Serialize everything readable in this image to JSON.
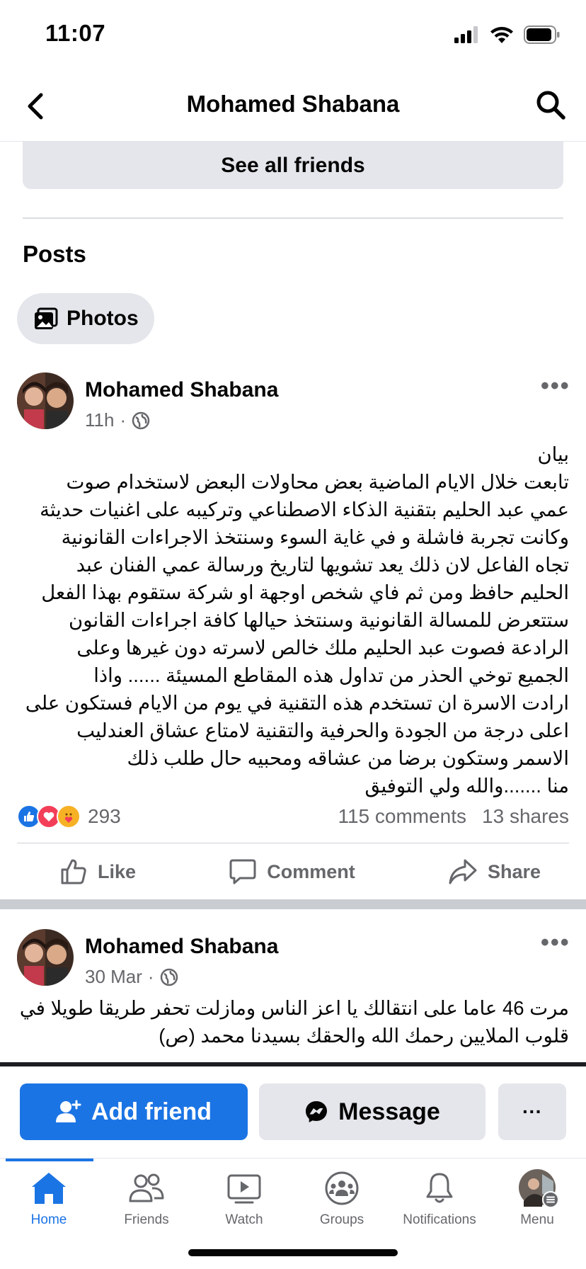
{
  "status_bar": {
    "time": "11:07"
  },
  "header": {
    "title": "Mohamed Shabana"
  },
  "friends": {
    "see_all_label": "See all friends"
  },
  "posts_section": {
    "heading": "Posts",
    "photos_chip": "Photos"
  },
  "post1": {
    "author": "Mohamed Shabana",
    "time": "11h",
    "body_lines": [
      "بيان",
      "تابعت خلال الايام الماضية بعض محاولات البعض لاستخدام صوت",
      "عمي عبد الحليم بتقنية الذكاء الاصطناعي وتركيبه على اغنيات حديثة",
      "وكانت تجربة فاشلة و في غاية السوء وسنتخذ الاجراءات القانونية",
      "تجاه الفاعل لان ذلك يعد تشويها لتاريخ ورسالة عمي الفنان عبد",
      "الحليم حافظ ومن ثم فاي شخص اوجهة او شركة ستقوم بهذا الفعل",
      "ستتعرض للمسالة القانونية وسنتخذ حيالها كافة اجراءات القانون",
      "الرادعة فصوت عبد الحليم ملك خالص لاسرته دون غيرها وعلى",
      "الجميع توخي الحذر من تداول هذه المقاطع المسيئة ...... واذا",
      "ارادت الاسرة ان تستخدم هذه التقنية في يوم من الايام فستكون على",
      "اعلى درجة من الجودة والحرفية والتقنية لامتاع عشاق العندليب",
      "الاسمر وستكون برضا من عشاقه ومحبيه حال طلب ذلك",
      "منا .......والله ولي التوفيق"
    ],
    "reaction_count": "293",
    "comments": "115 comments",
    "shares": "13 shares",
    "actions": {
      "like": "Like",
      "comment": "Comment",
      "share": "Share"
    }
  },
  "post2": {
    "author": "Mohamed Shabana",
    "time": "30 Mar",
    "body_lines": [
      "مرت 46 عاما على انتقالك يا اعز الناس ومازلت تحفر طريقا طويلا في",
      "قلوب الملايين رحمك الله والحقك بسيدنا محمد (ص)"
    ]
  },
  "cta": {
    "add_friend": "Add friend",
    "message": "Message",
    "more": "···"
  },
  "tabs": [
    {
      "label": "Home",
      "icon": "home-icon",
      "active": true
    },
    {
      "label": "Friends",
      "icon": "friends-icon",
      "active": false
    },
    {
      "label": "Watch",
      "icon": "watch-icon",
      "active": false
    },
    {
      "label": "Groups",
      "icon": "groups-icon",
      "active": false
    },
    {
      "label": "Notifications",
      "icon": "bell-icon",
      "active": false
    },
    {
      "label": "Menu",
      "icon": "menu-avatar",
      "active": false
    }
  ],
  "colors": {
    "accent": "#1b74e4",
    "secondary_text": "#65676b",
    "button_gray": "#e4e6eb"
  }
}
